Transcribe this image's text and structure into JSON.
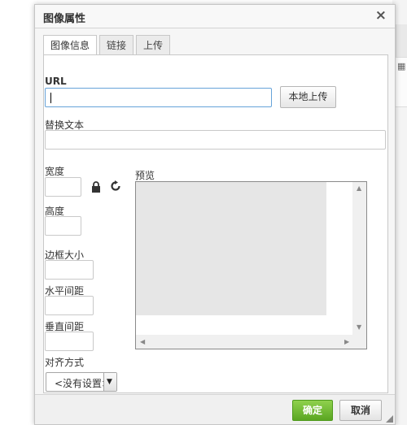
{
  "dialog": {
    "title": "图像属性",
    "close_glyph": "×"
  },
  "tabs": [
    {
      "label": "图像信息",
      "active": true
    },
    {
      "label": "链接",
      "active": false
    },
    {
      "label": "上传",
      "active": false
    }
  ],
  "form": {
    "url_label": "URL",
    "url_value": "",
    "upload_button": "本地上传",
    "alt_label": "替换文本",
    "alt_value": "",
    "width_label": "宽度",
    "height_label": "高度",
    "border_label": "边框大小",
    "hspace_label": "水平间距",
    "vspace_label": "垂直间距",
    "align_label": "对齐方式",
    "align_value": "<没有设置>",
    "preview_label": "预览"
  },
  "icons": {
    "lock": "lock-icon",
    "reset": "reset-icon"
  },
  "footer": {
    "ok_label": "确定",
    "cancel_label": "取消"
  },
  "colors": {
    "ok_button": "#5aa622",
    "focus_border": "#66a3d9"
  }
}
